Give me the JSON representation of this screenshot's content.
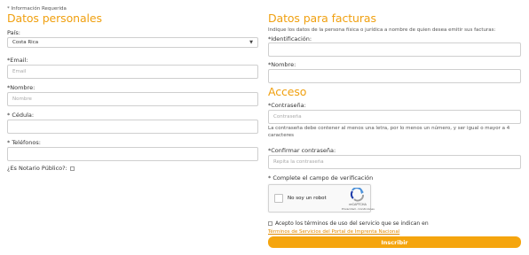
{
  "required_note": "* Información Requerida",
  "personal": {
    "title": "Datos personales",
    "country_label": "País:",
    "country_value": "Costa Rica",
    "email_label": "*Email:",
    "email_placeholder": "Email",
    "name_label": "*Nombre:",
    "name_placeholder": "Nombre",
    "id_label": "* Cédula:",
    "phones_label": "* Teléfonos:",
    "notary_label": "¿Es Notario Público?:"
  },
  "billing": {
    "title": "Datos para facturas",
    "description": "Indique los datos de la persona física o jurídica a nombre de quien desea emitir sus facturas:",
    "id_label": "*Identificación:",
    "name_label": "*Nombre:"
  },
  "access": {
    "title": "Acceso",
    "password_label": "*Contraseña:",
    "password_placeholder": "Contraseña",
    "password_hint": "La contraseña debe contener al menos una letra, por lo menos un número, y ser igual o mayor a 4 caracteres",
    "confirm_label": "*Confirmar contraseña:",
    "confirm_placeholder": "Repita la contraseña",
    "captcha_label": "* Complete el campo de verificación",
    "captcha": {
      "text": "No soy un robot",
      "brand": "reCAPTCHA",
      "privacy": "Privacidad - Condiciones"
    },
    "terms_text": "Acepto los términos de uso del servicio que se indican en",
    "terms_link": "Términos de Servicios del Portal de Imprenta Nacional",
    "submit_label": "Inscribir"
  },
  "colors": {
    "accent": "#f0a010",
    "button": "#f5a50e"
  }
}
